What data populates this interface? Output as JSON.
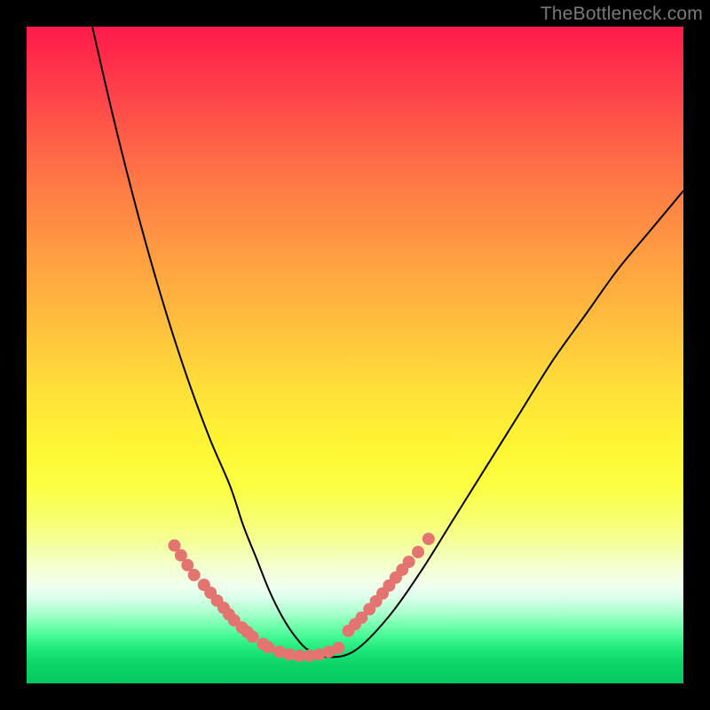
{
  "watermark": "TheBottleneck.com",
  "chart_data": {
    "type": "line",
    "title": "",
    "xlabel": "",
    "ylabel": "",
    "xlim": [
      0,
      100
    ],
    "ylim": [
      0,
      100
    ],
    "grid": false,
    "legend": false,
    "series": [
      {
        "name": "bottleneck-curve",
        "x": [
          10,
          13,
          16,
          19,
          22,
          25,
          28,
          31,
          33,
          35,
          37,
          39,
          41,
          43,
          46,
          50,
          55,
          60,
          65,
          70,
          75,
          80,
          85,
          90,
          95,
          100
        ],
        "y": [
          100,
          87,
          75,
          64,
          54,
          45,
          37,
          30,
          24,
          19,
          14,
          10,
          7,
          5,
          4,
          5,
          10,
          17,
          25,
          33,
          41,
          49,
          56,
          63,
          69,
          75
        ],
        "color": "#000000"
      },
      {
        "name": "highlight-dots-left",
        "x": [
          22.5,
          23.5,
          24.5,
          25.5,
          27,
          28,
          29,
          30,
          30.8,
          31.6,
          32.8,
          33.6,
          34.4,
          36,
          36.8
        ],
        "y": [
          21,
          19.5,
          18,
          16.5,
          15,
          13.8,
          12.6,
          11.5,
          10.5,
          9.6,
          8.5,
          7.8,
          7.1,
          6,
          5.5
        ],
        "color": "#e3746f"
      },
      {
        "name": "highlight-dots-right",
        "x": [
          49,
          50,
          51,
          52.2,
          53.2,
          54.2,
          55.2,
          56.2,
          57.2,
          58.2,
          59.6,
          61.2
        ],
        "y": [
          8,
          9,
          10,
          11.3,
          12.5,
          13.7,
          14.9,
          16.1,
          17.3,
          18.5,
          20,
          22
        ],
        "color": "#e3746f"
      },
      {
        "name": "highlight-dots-bottom",
        "x": [
          38.5,
          40,
          41.5,
          43,
          44.5,
          46,
          47.5
        ],
        "y": [
          4.8,
          4.4,
          4.2,
          4.2,
          4.4,
          4.8,
          5.4
        ],
        "color": "#e3746f"
      }
    ]
  }
}
